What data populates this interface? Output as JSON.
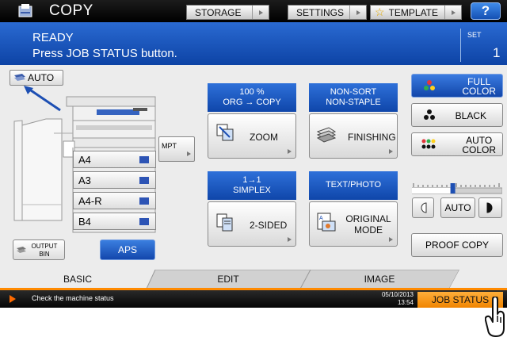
{
  "header": {
    "title": "COPY",
    "buttons": {
      "storage": "STORAGE",
      "settings": "SETTINGS",
      "template": "TEMPLATE",
      "help": "?"
    }
  },
  "status": {
    "line1": "READY",
    "line2": "Press JOB STATUS button.",
    "set_label": "SET",
    "set_value": "1"
  },
  "paper": {
    "auto_label": "AUTO",
    "trays": [
      "A4",
      "A3",
      "A4-R",
      "B4"
    ],
    "mpt": "MPT",
    "output_bin": [
      "OUTPUT",
      "BIN"
    ],
    "aps": "APS"
  },
  "zoom": {
    "setting_line1": "100 %",
    "setting_line2": "ORG → COPY",
    "label": "ZOOM"
  },
  "finishing": {
    "setting_line1": "NON-SORT",
    "setting_line2": "NON-STAPLE",
    "label": "FINISHING"
  },
  "sided": {
    "setting_line1": "1→1",
    "setting_line2": "SIMPLEX",
    "label": "2-SIDED"
  },
  "original_mode": {
    "setting_line1": "TEXT/PHOTO",
    "label_line1": "ORIGINAL",
    "label_line2": "MODE"
  },
  "color": {
    "full_line1": "FULL",
    "full_line2": "COLOR",
    "black": "BLACK",
    "auto_line1": "AUTO",
    "auto_line2": "COLOR",
    "selected": "full-color"
  },
  "density": {
    "auto": "AUTO",
    "level_fraction": 0.45
  },
  "proof_copy": "PROOF COPY",
  "tabs": {
    "basic": "BASIC",
    "edit": "EDIT",
    "image": "IMAGE",
    "active": "basic"
  },
  "footer": {
    "message": "Check the machine status",
    "date": "05/10/2013",
    "time": "13:54",
    "job_status": "JOB STATUS"
  },
  "colors": {
    "accent_blue": "#1a56c0",
    "accent_orange": "#f08400",
    "bar_black": "#000000"
  }
}
